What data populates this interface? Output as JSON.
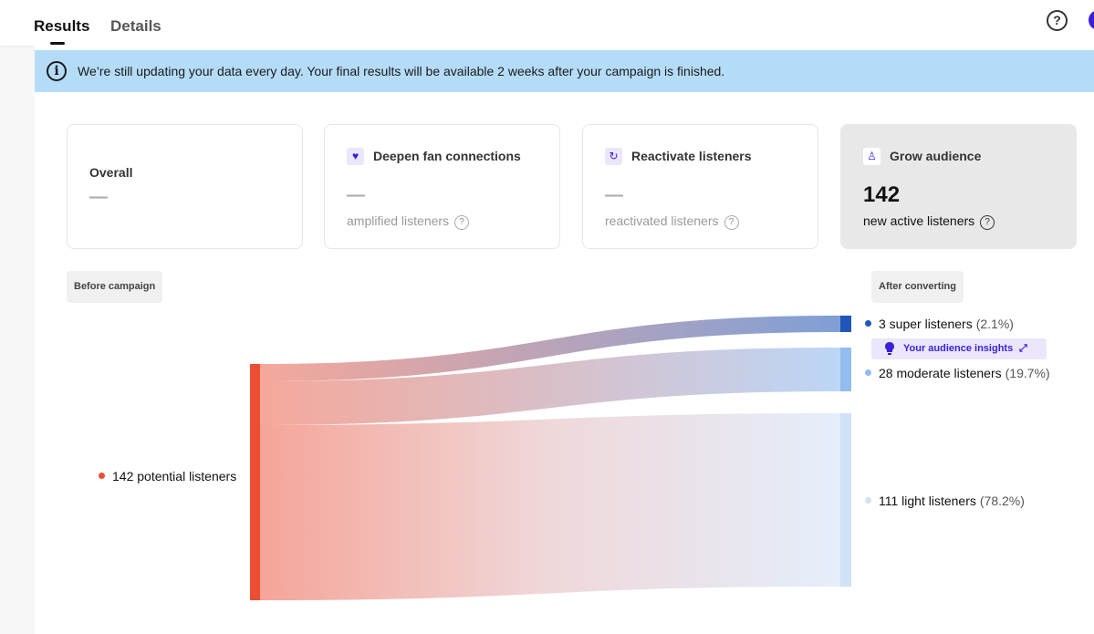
{
  "tabs": {
    "results": "Results",
    "details": "Details"
  },
  "top_icons": {
    "help": "help-icon",
    "avatar": "avatar"
  },
  "banner": {
    "icon": "info-icon",
    "text": "We’re still updating your data every day. Your final results will be available 2 weeks after your campaign is finished."
  },
  "cards": {
    "overall": {
      "title": "Overall",
      "value": "—"
    },
    "deepen": {
      "title": "Deepen fan connections",
      "value": "—",
      "sub": "amplified listeners",
      "icon": "heart-icon"
    },
    "reactivate": {
      "title": "Reactivate listeners",
      "value": "—",
      "sub": "reactivated listeners",
      "icon": "refresh-icon"
    },
    "grow": {
      "title": "Grow audience",
      "value": "142",
      "sub": "new active listeners",
      "icon": "person-plus-icon"
    }
  },
  "flow": {
    "before_label": "Before campaign",
    "after_label": "After converting",
    "source": {
      "label": "142 potential listeners",
      "color": "#ea4f33"
    },
    "targets": [
      {
        "label": "3 super listeners",
        "pct": "(2.1%)",
        "color": "#1f56b8"
      },
      {
        "label": "28 moderate listeners",
        "pct": "(19.7%)",
        "color": "#92bdee"
      },
      {
        "label": "111 light listeners",
        "pct": "(78.2%)",
        "color": "#cfe2f8"
      }
    ],
    "insights_label": "Your audience insights",
    "help_glyph": "?"
  }
}
